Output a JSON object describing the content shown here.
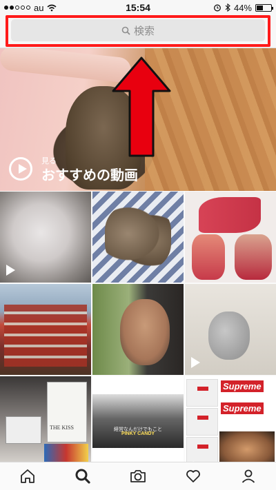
{
  "status_bar": {
    "carrier": "au",
    "time": "15:54",
    "battery": "44%",
    "battery_level": 0.44
  },
  "search": {
    "placeholder": "検索",
    "icon": "search-icon"
  },
  "annotation": {
    "highlight_color": "#ff1a1a",
    "arrow_color": "#e8000f"
  },
  "featured": {
    "watch_label": "見る",
    "title": "おすすめの動画"
  },
  "grid": {
    "bag_text": "THE KISS",
    "video_caption_line1": "経営なんだけでもこと",
    "video_caption_line2": "PINKY CANDY",
    "brand_text": "Supreme"
  },
  "tab_bar": {
    "items": [
      "home-icon",
      "search-icon",
      "camera-icon",
      "heart-icon",
      "profile-icon"
    ],
    "active": "search-icon"
  }
}
